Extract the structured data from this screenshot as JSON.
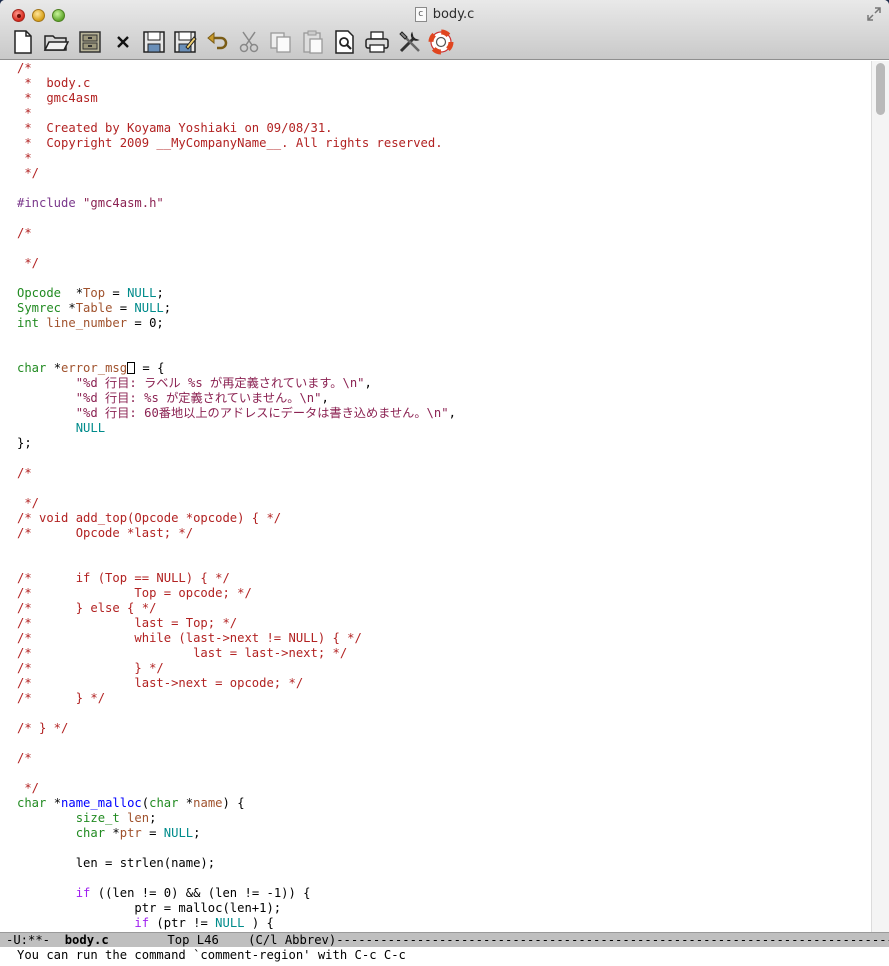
{
  "window": {
    "title": "body.c",
    "file_badge": "c"
  },
  "toolbar": {
    "buttons": [
      {
        "name": "new-file",
        "tooltip": ""
      },
      {
        "name": "open-folder"
      },
      {
        "name": "dired-cabinet"
      },
      {
        "name": "close-buffer"
      },
      {
        "name": "save"
      },
      {
        "name": "save-as"
      },
      {
        "name": "undo"
      },
      {
        "name": "cut"
      },
      {
        "name": "copy"
      },
      {
        "name": "paste"
      },
      {
        "name": "search"
      },
      {
        "name": "print"
      },
      {
        "name": "preferences"
      },
      {
        "name": "help"
      }
    ],
    "close_glyph": "×"
  },
  "code_lines": [
    [
      [
        "c",
        "/*"
      ]
    ],
    [
      [
        "c",
        " *  body.c"
      ]
    ],
    [
      [
        "c",
        " *  gmc4asm"
      ]
    ],
    [
      [
        "c",
        " *"
      ]
    ],
    [
      [
        "c",
        " *  Created by Koyama Yoshiaki on 09/08/31."
      ]
    ],
    [
      [
        "c",
        " *  Copyright 2009 __MyCompanyName__. All rights reserved."
      ]
    ],
    [
      [
        "c",
        " *"
      ]
    ],
    [
      [
        "c",
        " */"
      ]
    ],
    [],
    [
      [
        "p",
        "#include "
      ],
      [
        "s",
        "\"gmc4asm.h\""
      ]
    ],
    [],
    [
      [
        "c",
        "/*"
      ]
    ],
    [],
    [
      [
        "c",
        " */"
      ]
    ],
    [],
    [
      [
        "t",
        "Opcode"
      ],
      [
        "",
        "  *"
      ],
      [
        "v",
        "Top"
      ],
      [
        "",
        " = "
      ],
      [
        "n",
        "NULL"
      ],
      [
        "",
        ";"
      ]
    ],
    [
      [
        "t",
        "Symrec"
      ],
      [
        "",
        " *"
      ],
      [
        "v",
        "Table"
      ],
      [
        "",
        " = "
      ],
      [
        "n",
        "NULL"
      ],
      [
        "",
        ";"
      ]
    ],
    [
      [
        "t",
        "int"
      ],
      [
        "",
        " "
      ],
      [
        "v",
        "line_number"
      ],
      [
        "",
        " = 0;"
      ]
    ],
    [],
    [],
    [
      [
        "t",
        "char"
      ],
      [
        "",
        " *"
      ],
      [
        "v",
        "error_msg"
      ],
      [
        "CURSOR",
        ""
      ],
      [
        "",
        " = {"
      ]
    ],
    [
      [
        "",
        "        "
      ],
      [
        "s",
        "\"%d 行目: ラベル %s が再定義されています。\\n\""
      ],
      [
        "",
        ","
      ]
    ],
    [
      [
        "",
        "        "
      ],
      [
        "s",
        "\"%d 行目: %s が定義されていません。\\n\""
      ],
      [
        "",
        ","
      ]
    ],
    [
      [
        "",
        "        "
      ],
      [
        "s",
        "\"%d 行目: 60番地以上のアドレスにデータは書き込めません。\\n\""
      ],
      [
        "",
        ","
      ]
    ],
    [
      [
        "",
        "        "
      ],
      [
        "n",
        "NULL"
      ]
    ],
    [
      [
        "",
        "};"
      ]
    ],
    [],
    [
      [
        "c",
        "/*"
      ]
    ],
    [],
    [
      [
        "c",
        " */"
      ]
    ],
    [
      [
        "c",
        "/* void add_top(Opcode *opcode) { */"
      ]
    ],
    [
      [
        "c",
        "/*      Opcode *last; */"
      ]
    ],
    [],
    [],
    [
      [
        "c",
        "/*      if (Top == NULL) { */"
      ]
    ],
    [
      [
        "c",
        "/*              Top = opcode; */"
      ]
    ],
    [
      [
        "c",
        "/*      } else { */"
      ]
    ],
    [
      [
        "c",
        "/*              last = Top; */"
      ]
    ],
    [
      [
        "c",
        "/*              while (last->next != NULL) { */"
      ]
    ],
    [
      [
        "c",
        "/*                      last = last->next; */"
      ]
    ],
    [
      [
        "c",
        "/*              } */"
      ]
    ],
    [
      [
        "c",
        "/*              last->next = opcode; */"
      ]
    ],
    [
      [
        "c",
        "/*      } */"
      ]
    ],
    [],
    [
      [
        "c",
        "/* } */"
      ]
    ],
    [],
    [
      [
        "c",
        "/*"
      ]
    ],
    [],
    [
      [
        "c",
        " */"
      ]
    ],
    [
      [
        "t",
        "char"
      ],
      [
        "",
        " *"
      ],
      [
        "f",
        "name_malloc"
      ],
      [
        "",
        "("
      ],
      [
        "t",
        "char"
      ],
      [
        "",
        " *"
      ],
      [
        "v",
        "name"
      ],
      [
        "",
        ") {"
      ]
    ],
    [
      [
        "",
        "        "
      ],
      [
        "t",
        "size_t"
      ],
      [
        "",
        " "
      ],
      [
        "v",
        "len"
      ],
      [
        "",
        ";"
      ]
    ],
    [
      [
        "",
        "        "
      ],
      [
        "t",
        "char"
      ],
      [
        "",
        " *"
      ],
      [
        "v",
        "ptr"
      ],
      [
        "",
        " = "
      ],
      [
        "n",
        "NULL"
      ],
      [
        "",
        ";"
      ]
    ],
    [],
    [
      [
        "",
        "        len = strlen(name);"
      ]
    ],
    [],
    [
      [
        "",
        "        "
      ],
      [
        "k",
        "if"
      ],
      [
        "",
        " ((len != 0) && (len != -1)) {"
      ]
    ],
    [
      [
        "",
        "                ptr = malloc(len+1);"
      ]
    ],
    [
      [
        "",
        "                "
      ],
      [
        "k",
        "if"
      ],
      [
        "",
        " (ptr != "
      ],
      [
        "n",
        "NULL"
      ],
      [
        "",
        " ) {"
      ]
    ]
  ],
  "modeline": {
    "prefix": "-U:**-  ",
    "buffer_name": "body.c",
    "position": "        Top L46    ",
    "mode": "(C/l Abbrev)",
    "fill": "------------------------------------------------------------------------------------------------"
  },
  "minibuffer": {
    "message": "You can run the command `comment-region' with C-c C-c"
  },
  "colors": {
    "comment": "#b22222",
    "type": "#228b22",
    "variable": "#a0522d",
    "keyword": "#a020f0",
    "string": "#8b2252",
    "constant": "#008b8b",
    "function": "#0000ff",
    "preprocessor": "#7a378b"
  }
}
